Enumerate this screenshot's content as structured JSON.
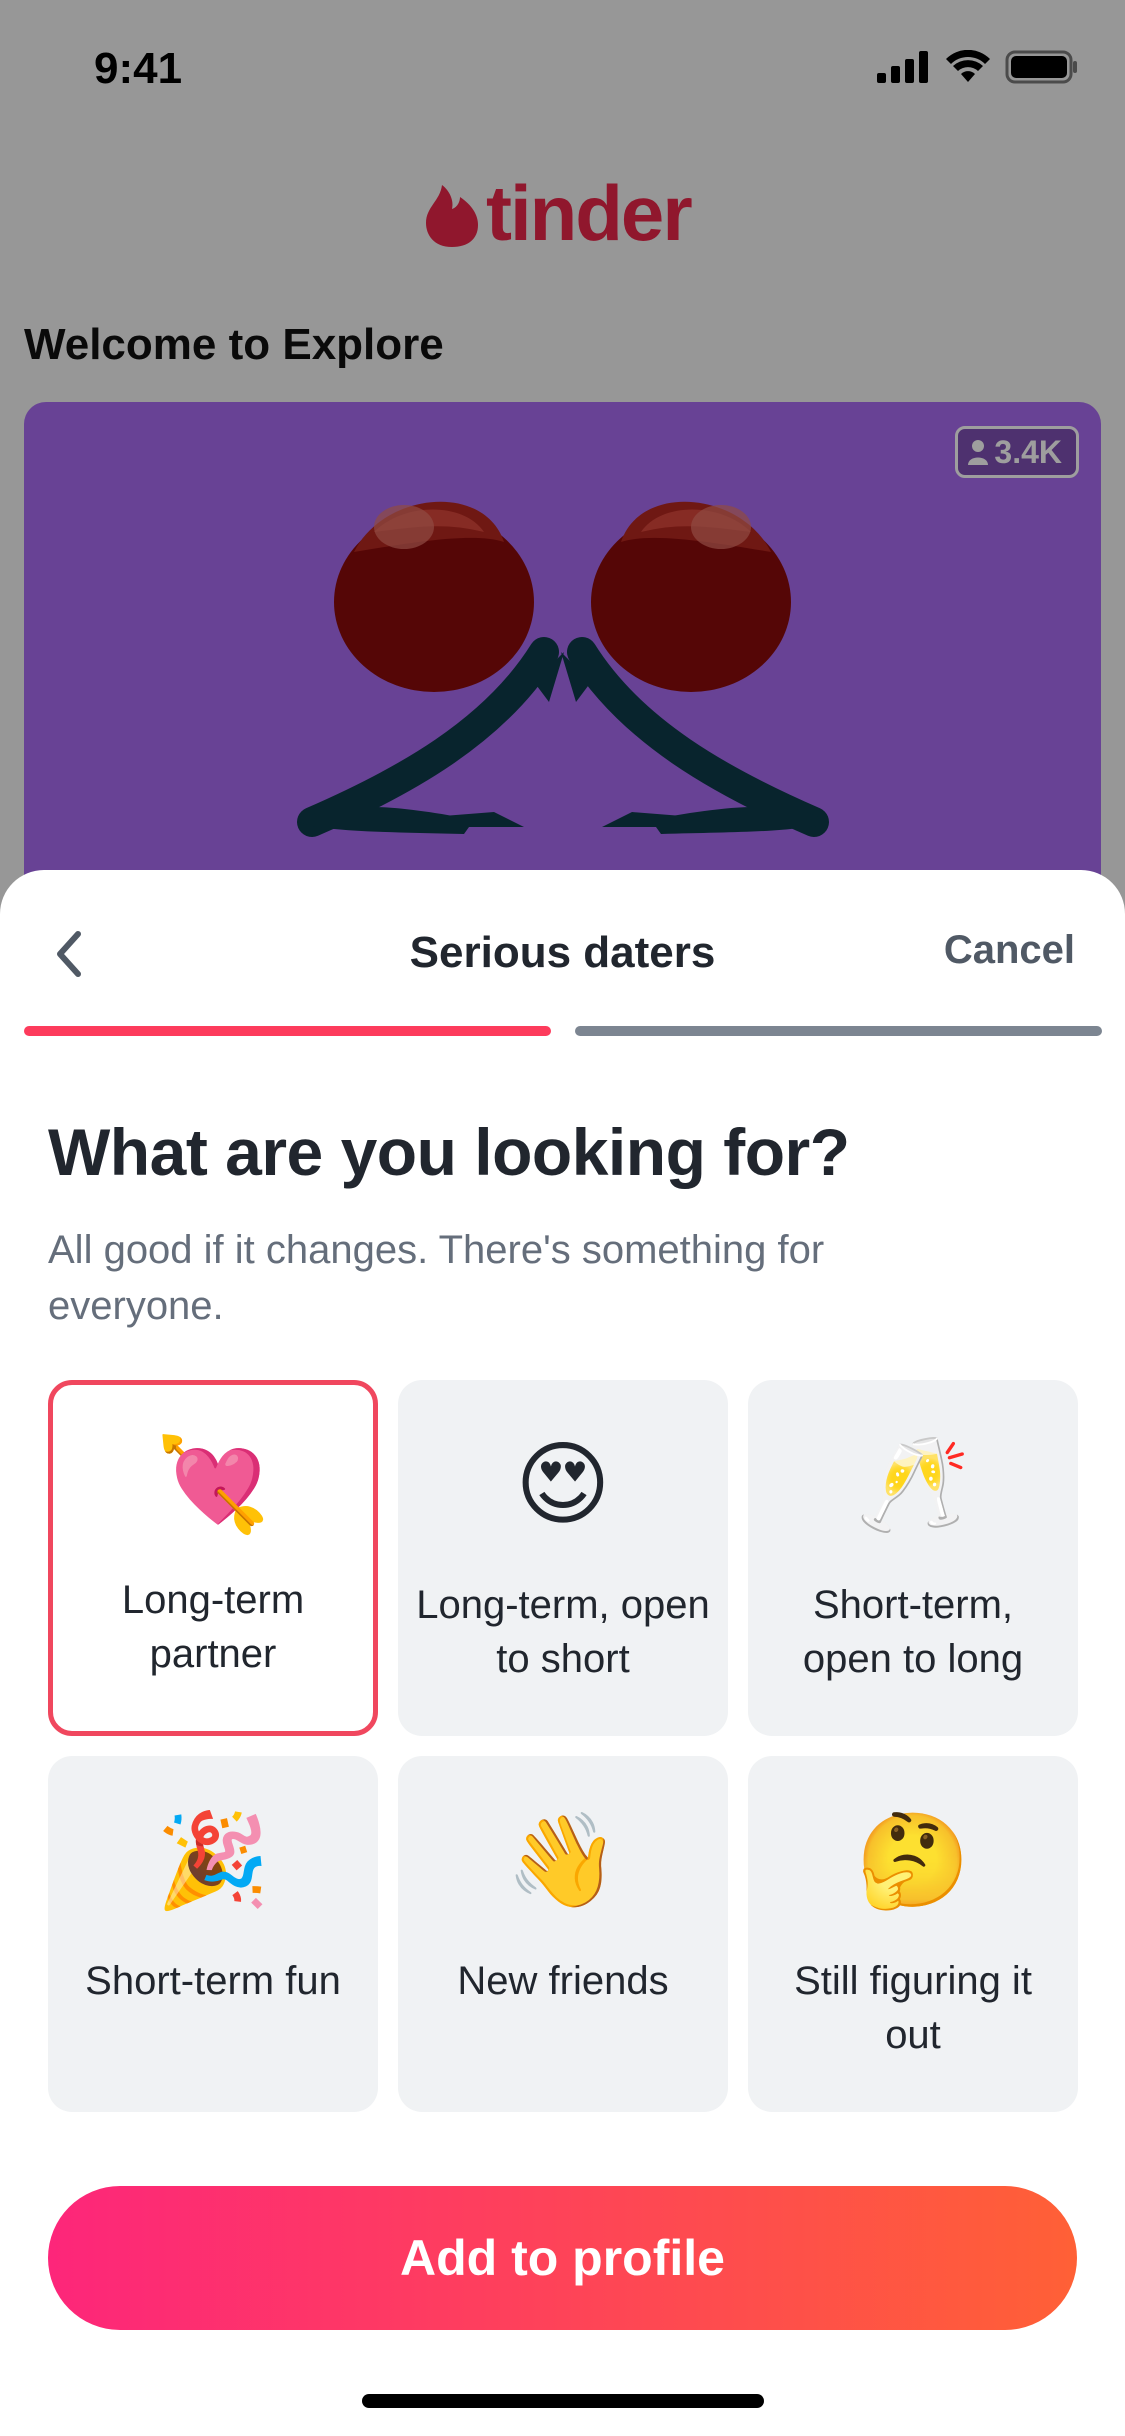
{
  "status_bar": {
    "time": "9:41"
  },
  "app": {
    "brand": "tinder",
    "brand_color": "#e8264a"
  },
  "background": {
    "section_title": "Welcome to Explore",
    "card": {
      "background_color": "#a86bf0",
      "member_count": "3.4K",
      "illustration": "roses-icon"
    }
  },
  "sheet": {
    "title": "Serious daters",
    "cancel_label": "Cancel",
    "back_icon": "chevron-left-icon",
    "progress": {
      "steps": 2,
      "current": 1
    },
    "headline": "What are you looking for?",
    "subtext": "All good if it changes. There's something for everyone.",
    "options": [
      {
        "emoji": "💘",
        "label": "Long-term partner",
        "selected": true
      },
      {
        "emoji": "😍",
        "label": "Long-term, open to short",
        "selected": false
      },
      {
        "emoji": "🥂",
        "label": "Short-term, open to long",
        "selected": false
      },
      {
        "emoji": "🎉",
        "label": "Short-term fun",
        "selected": false
      },
      {
        "emoji": "👋",
        "label": "New friends",
        "selected": false
      },
      {
        "emoji": "🤔",
        "label": "Still figuring it out",
        "selected": false
      }
    ],
    "primary_button": "Add to profile",
    "accent_gradient": [
      "#fd267a",
      "#ff6036"
    ]
  }
}
